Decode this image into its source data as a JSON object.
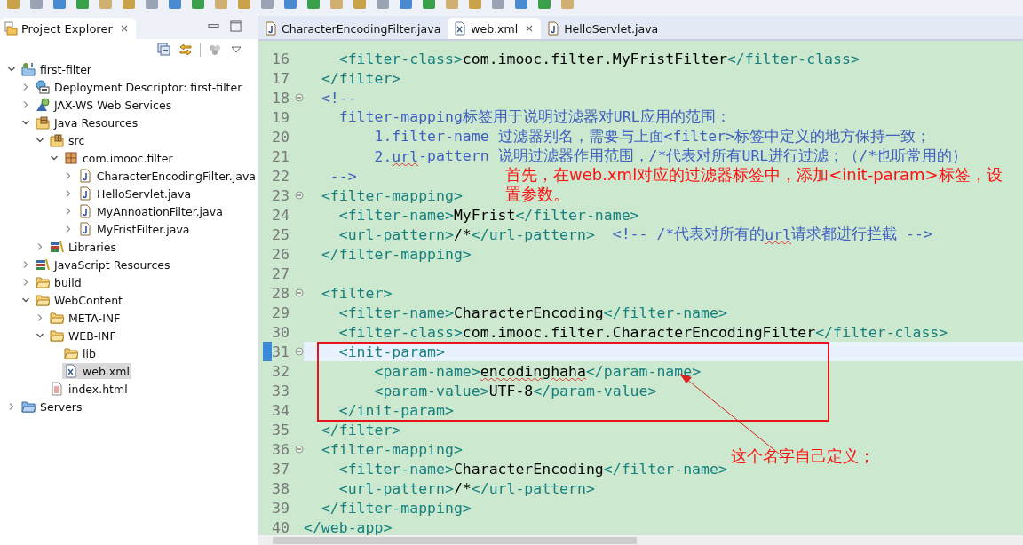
{
  "project_explorer": {
    "title": "Project Explorer",
    "tree": [
      {
        "label": "first-filter",
        "kind": "project",
        "expanded": true,
        "selected": false,
        "children": [
          {
            "label": "Deployment Descriptor: first-filter",
            "kind": "descriptor",
            "expanded": false,
            "selected": false
          },
          {
            "label": "JAX-WS Web Services",
            "kind": "webservice",
            "expanded": false,
            "selected": false
          },
          {
            "label": "Java Resources",
            "kind": "resources",
            "expanded": true,
            "selected": false,
            "children": [
              {
                "label": "src",
                "kind": "srcfolder",
                "expanded": true,
                "selected": false,
                "children": [
                  {
                    "label": "com.imooc.filter",
                    "kind": "package",
                    "expanded": true,
                    "selected": false,
                    "children": [
                      {
                        "label": "CharacterEncodingFilter.java",
                        "kind": "java",
                        "expanded": false,
                        "selected": false
                      },
                      {
                        "label": "HelloServlet.java",
                        "kind": "java",
                        "expanded": false,
                        "selected": false
                      },
                      {
                        "label": "MyAnnoationFilter.java",
                        "kind": "java",
                        "expanded": false,
                        "selected": false
                      },
                      {
                        "label": "MyFristFilter.java",
                        "kind": "java",
                        "expanded": false,
                        "selected": false
                      }
                    ]
                  }
                ]
              },
              {
                "label": "Libraries",
                "kind": "library",
                "expanded": false,
                "selected": false
              }
            ]
          },
          {
            "label": "JavaScript Resources",
            "kind": "library",
            "expanded": false,
            "selected": false
          },
          {
            "label": "build",
            "kind": "folder",
            "expanded": false,
            "selected": false
          },
          {
            "label": "WebContent",
            "kind": "folder",
            "expanded": true,
            "selected": false,
            "children": [
              {
                "label": "META-INF",
                "kind": "folder",
                "expanded": false,
                "selected": false
              },
              {
                "label": "WEB-INF",
                "kind": "folder",
                "expanded": true,
                "selected": false,
                "children": [
                  {
                    "label": "lib",
                    "kind": "folder",
                    "selected": false
                  },
                  {
                    "label": "web.xml",
                    "kind": "xml",
                    "selected": true
                  }
                ]
              },
              {
                "label": "index.html",
                "kind": "html",
                "selected": false
              }
            ]
          }
        ]
      },
      {
        "label": "Servers",
        "kind": "servers",
        "expanded": false,
        "selected": false
      }
    ]
  },
  "editor": {
    "tabs": [
      {
        "label": "CharacterEncodingFilter.java",
        "kind": "java",
        "selected": false
      },
      {
        "label": "web.xml",
        "kind": "xml",
        "selected": true
      },
      {
        "label": "HelloServlet.java",
        "kind": "java",
        "selected": false
      }
    ],
    "lines": [
      {
        "num": "16",
        "fold": false,
        "current": false,
        "segments": [
          {
            "kind": "tag",
            "text": "    <filter-class>"
          },
          {
            "kind": "text",
            "text": "com.imooc.filter.MyFristFilter"
          },
          {
            "kind": "tag",
            "text": "</filter-class>"
          }
        ]
      },
      {
        "num": "17",
        "fold": false,
        "current": false,
        "segments": [
          {
            "kind": "tag",
            "text": "  </filter>"
          }
        ]
      },
      {
        "num": "18",
        "fold": true,
        "current": false,
        "segments": [
          {
            "kind": "comment",
            "text": "  <!--"
          }
        ]
      },
      {
        "num": "19",
        "fold": false,
        "current": false,
        "segments": [
          {
            "kind": "comment",
            "text": "    filter-mapping标签用于说明过滤器对URL应用的范围："
          }
        ]
      },
      {
        "num": "20",
        "fold": false,
        "current": false,
        "segments": [
          {
            "kind": "comment",
            "text": "        1.filter-name 过滤器别名，需要与上面<filter>标签中定义的地方保持一致；"
          }
        ]
      },
      {
        "num": "21",
        "fold": false,
        "current": false,
        "segments": [
          {
            "kind": "comment",
            "text": "        2."
          },
          {
            "kind": "comment-typo",
            "text": "url"
          },
          {
            "kind": "comment",
            "text": "-pattern 说明过滤器作用范围，/*代表对所有URL进行过滤；（/*也听常用的）"
          }
        ]
      },
      {
        "num": "22",
        "fold": false,
        "current": false,
        "segments": [
          {
            "kind": "comment",
            "text": "   -->"
          }
        ]
      },
      {
        "num": "23",
        "fold": true,
        "current": false,
        "segments": [
          {
            "kind": "tag",
            "text": "  <filter-mapping>"
          }
        ]
      },
      {
        "num": "24",
        "fold": false,
        "current": false,
        "segments": [
          {
            "kind": "tag",
            "text": "    <filter-name>"
          },
          {
            "kind": "text",
            "text": "MyFrist"
          },
          {
            "kind": "tag",
            "text": "</filter-name>"
          }
        ]
      },
      {
        "num": "25",
        "fold": false,
        "current": false,
        "segments": [
          {
            "kind": "tag",
            "text": "    <url-pattern>"
          },
          {
            "kind": "text",
            "text": "/*"
          },
          {
            "kind": "tag",
            "text": "</url-pattern>"
          },
          {
            "kind": "comment",
            "text": "  <!-- /*代表对所有的"
          },
          {
            "kind": "comment-typo",
            "text": "url"
          },
          {
            "kind": "comment",
            "text": "请求都进行拦截 -->"
          }
        ]
      },
      {
        "num": "26",
        "fold": false,
        "current": false,
        "segments": [
          {
            "kind": "tag",
            "text": "  </filter-mapping>"
          }
        ]
      },
      {
        "num": "27",
        "fold": false,
        "current": false
      },
      {
        "num": "28",
        "fold": true,
        "current": false,
        "segments": [
          {
            "kind": "tag",
            "text": "  <filter>"
          }
        ]
      },
      {
        "num": "29",
        "fold": false,
        "current": false,
        "segments": [
          {
            "kind": "tag",
            "text": "    <filter-name>"
          },
          {
            "kind": "text",
            "text": "CharacterEncoding"
          },
          {
            "kind": "tag",
            "text": "</filter-name>"
          }
        ]
      },
      {
        "num": "30",
        "fold": false,
        "current": false,
        "segments": [
          {
            "kind": "tag",
            "text": "    <filter-class>"
          },
          {
            "kind": "text",
            "text": "com.imooc.filter.CharacterEncodingFilter"
          },
          {
            "kind": "tag",
            "text": "</filter-class>"
          }
        ]
      },
      {
        "num": "31",
        "fold": true,
        "current": true,
        "segments": [
          {
            "kind": "tag",
            "text": "    <init-param>"
          }
        ]
      },
      {
        "num": "32",
        "fold": false,
        "current": false,
        "segments": [
          {
            "kind": "tag",
            "text": "        <param-name>"
          },
          {
            "kind": "text-typo",
            "text": "encodinghaha"
          },
          {
            "kind": "tag",
            "text": "</param-name>"
          }
        ]
      },
      {
        "num": "33",
        "fold": false,
        "current": false,
        "segments": [
          {
            "kind": "tag",
            "text": "        <param-value>"
          },
          {
            "kind": "text",
            "text": "UTF-8"
          },
          {
            "kind": "tag",
            "text": "</param-value>"
          }
        ]
      },
      {
        "num": "34",
        "fold": false,
        "current": false,
        "segments": [
          {
            "kind": "tag",
            "text": "    </init-param>"
          }
        ]
      },
      {
        "num": "35",
        "fold": false,
        "current": false,
        "segments": [
          {
            "kind": "tag",
            "text": "  </filter>"
          }
        ]
      },
      {
        "num": "36",
        "fold": true,
        "current": false,
        "segments": [
          {
            "kind": "tag",
            "text": "  <filter-mapping>"
          }
        ]
      },
      {
        "num": "37",
        "fold": false,
        "current": false,
        "segments": [
          {
            "kind": "tag",
            "text": "    <filter-name>"
          },
          {
            "kind": "text",
            "text": "CharacterEncoding"
          },
          {
            "kind": "tag",
            "text": "</filter-name>"
          }
        ]
      },
      {
        "num": "38",
        "fold": false,
        "current": false,
        "segments": [
          {
            "kind": "tag",
            "text": "    <url-pattern>"
          },
          {
            "kind": "text",
            "text": "/*"
          },
          {
            "kind": "tag",
            "text": "</url-pattern>"
          }
        ]
      },
      {
        "num": "39",
        "fold": false,
        "current": false,
        "segments": [
          {
            "kind": "tag",
            "text": "  </filter-mapping>"
          }
        ]
      },
      {
        "num": "40",
        "fold": false,
        "current": false,
        "segments": [
          {
            "kind": "tag",
            "text": "</web-app>"
          }
        ]
      }
    ]
  },
  "annotations": {
    "note": "首先，在web.xml对应的过滤器标签中，添加<init-param>标签，设置参数。",
    "label": "这个名字自己定义；"
  }
}
